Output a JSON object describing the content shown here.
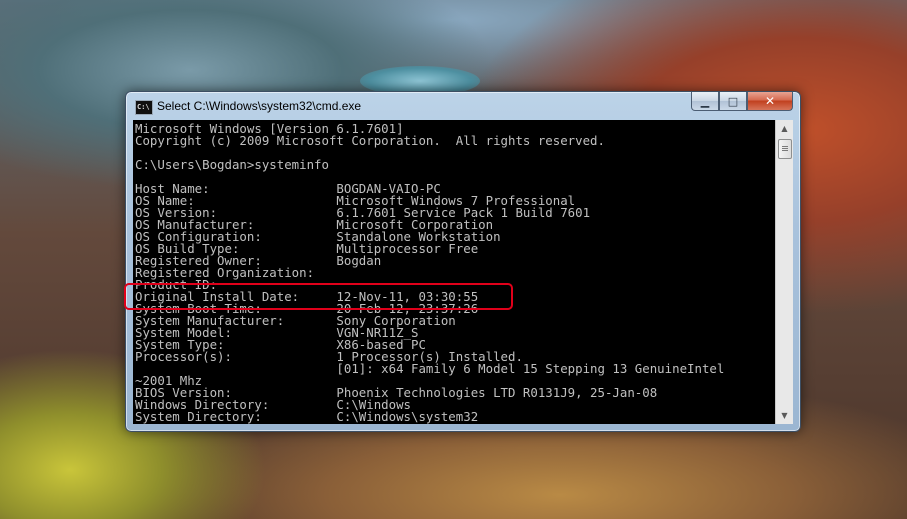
{
  "window": {
    "title": "Select C:\\Windows\\system32\\cmd.exe",
    "icon_label": "C:\\",
    "buttons": {
      "minimize": "▁",
      "maximize": "□",
      "close": "✕"
    }
  },
  "console": {
    "lines": [
      "Microsoft Windows [Version 6.1.7601]",
      "Copyright (c) 2009 Microsoft Corporation.  All rights reserved.",
      "",
      "C:\\Users\\Bogdan>systeminfo",
      "",
      "Host Name:                 BOGDAN-VAIO-PC",
      "OS Name:                   Microsoft Windows 7 Professional",
      "OS Version:                6.1.7601 Service Pack 1 Build 7601",
      "OS Manufacturer:           Microsoft Corporation",
      "OS Configuration:          Standalone Workstation",
      "OS Build Type:             Multiprocessor Free",
      "Registered Owner:          Bogdan",
      "Registered Organization:",
      "Product ID:",
      "Original Install Date:     12-Nov-11, 03:30:55",
      "System Boot Time:          20-Feb-12, 23:37:26",
      "System Manufacturer:       Sony Corporation",
      "System Model:              VGN-NR11Z_S",
      "System Type:               X86-based PC",
      "Processor(s):              1 Processor(s) Installed.",
      "                           [01]: x64 Family 6 Model 15 Stepping 13 GenuineIntel",
      "~2001 Mhz",
      "BIOS Version:              Phoenix Technologies LTD R0131J9, 25-Jan-08",
      "Windows Directory:         C:\\Windows",
      "System Directory:          C:\\Windows\\system32"
    ]
  },
  "scrollbar": {
    "up_arrow": "▲",
    "down_arrow": "▼"
  },
  "colors": {
    "console_background": "#000000",
    "console_text": "#c0c0c0",
    "highlight_border": "#e0001a"
  }
}
